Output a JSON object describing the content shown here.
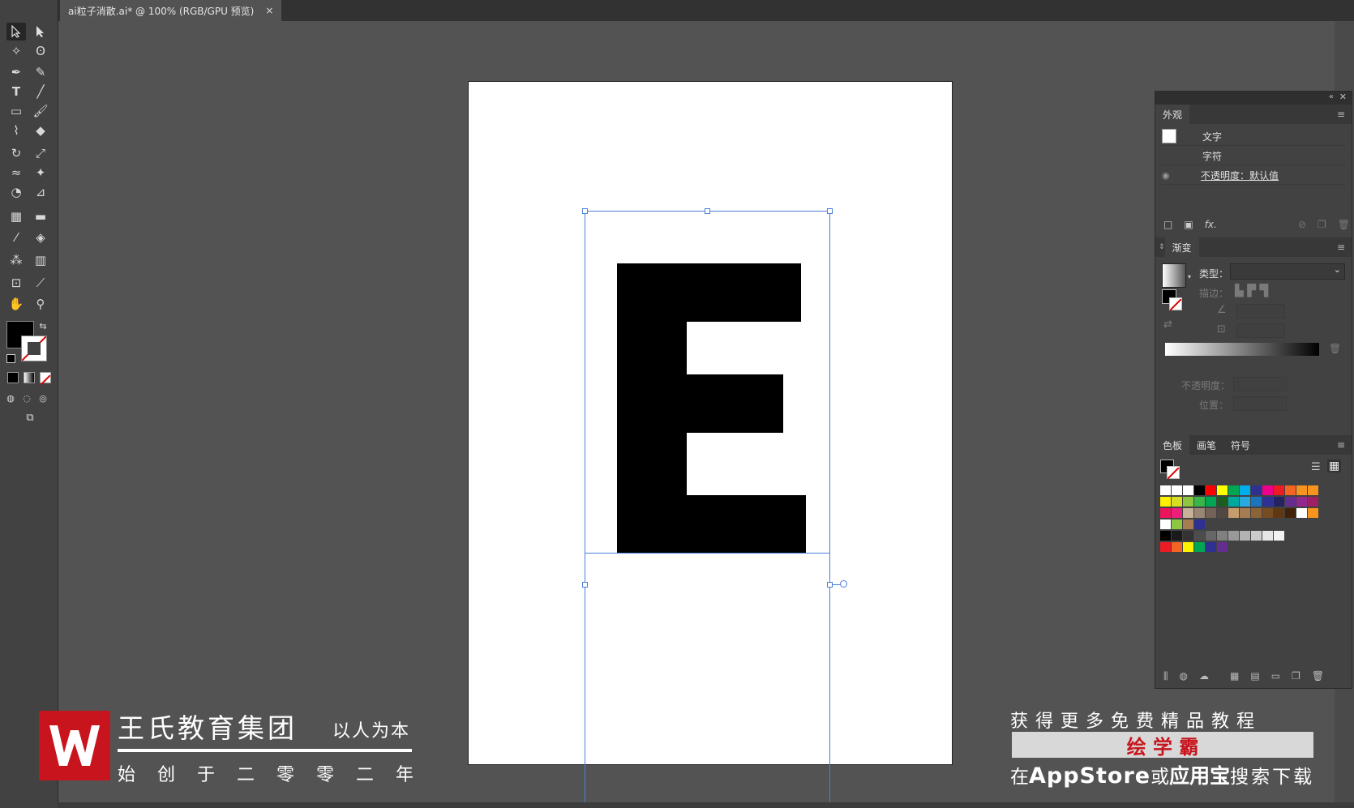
{
  "document": {
    "tab_title": "ai粒子消散.ai* @ 100% (RGB/GPU 预览)",
    "close_symbol": "×"
  },
  "canvas": {
    "letter": "E"
  },
  "appearance_panel": {
    "tab": "外观",
    "rows": [
      {
        "label": "文字"
      },
      {
        "label": "字符"
      },
      {
        "label": "不透明度：默认值"
      }
    ],
    "footer_fx": "fx."
  },
  "gradient_panel": {
    "tab": "渐变",
    "type_label": "类型：",
    "stroke_label": "描边：",
    "opacity_label": "不透明度：",
    "position_label": "位置："
  },
  "swatches_panel": {
    "tabs": [
      "色板",
      "画笔",
      "符号"
    ],
    "rows": [
      [
        "#ffffff",
        "#ffffff",
        "#ffffff",
        "#000000",
        "#ff0000",
        "#ffff00",
        "#00a651",
        "#00aeef",
        "#2e3192",
        "#ec008c",
        "#ed1c24",
        "#f26522",
        "#f7941d",
        "#f7941d"
      ],
      [
        "#fff200",
        "#d7df23",
        "#8dc63f",
        "#39b54a",
        "#00a651",
        "#1b5e20",
        "#00a99d",
        "#27aae1",
        "#1c75bc",
        "#2e3192",
        "#262262",
        "#662d91",
        "#92278f",
        "#9e1f63"
      ],
      [
        "#ed145b",
        "#ed1e79",
        "#c7b299",
        "#998675",
        "#736357",
        "#534741",
        "#c69c6d",
        "#a67c52",
        "#8c6239",
        "#754c24",
        "#603813",
        "#42210b",
        "#ffffff",
        "#f7941d"
      ],
      [
        "#ffffff",
        "#8dc63f",
        "#a67c52",
        "#2e3192"
      ],
      [
        "#000000",
        "#1a1a1a",
        "#333333",
        "#4d4d4d",
        "#666666",
        "#808080",
        "#999999",
        "#b3b3b3",
        "#cccccc",
        "#e6e6e6",
        "#f2f2f2"
      ],
      [
        "#ed1c24",
        "#f26522",
        "#fff200",
        "#00a651",
        "#2e3192",
        "#662d91"
      ]
    ]
  },
  "watermark": {
    "company": "王氏教育集团",
    "slogan": "以人为本",
    "founded": "始 创 于 二 零 零 二 年",
    "promo_line1": "获 得 更 多 免 费 精 品 教 程",
    "promo_app": "绘 学 霸",
    "promo_line3_a": "在",
    "promo_line3_b": "AppStore",
    "promo_line3_c": "或",
    "promo_line3_d": "应用宝",
    "promo_line3_e": "搜索下载"
  },
  "colors": {
    "accent_red": "#c8151d",
    "selection_blue": "#4a7fd8",
    "ui_dark": "#424242",
    "pasteboard": "#535353"
  }
}
